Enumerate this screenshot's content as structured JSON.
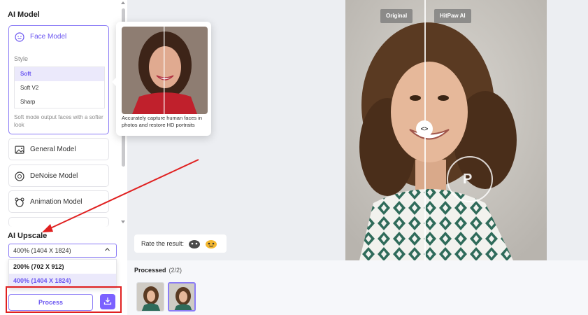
{
  "left_panel": {
    "ai_model_title": "AI Model",
    "face_model": {
      "label": "Face Model",
      "style_label": "Style",
      "styles": [
        "Soft",
        "Soft V2",
        "Sharp"
      ],
      "selected_style": "Soft",
      "description": "Soft mode output faces with a softer look"
    },
    "models": [
      {
        "label": "General Model",
        "icon": "image-icon"
      },
      {
        "label": "DeNoise Model",
        "icon": "denoise-icon"
      },
      {
        "label": "Animation Model",
        "icon": "animation-icon"
      }
    ],
    "ai_upscale_title": "AI Upscale",
    "upscale_selected": "400% (1404 X 1824)",
    "upscale_options": [
      "200% (702 X 912)",
      "400% (1404 X 1824)"
    ],
    "process_label": "Process"
  },
  "popover": {
    "text": "Accurately capture human faces in photos and restore HD portraits"
  },
  "preview": {
    "original_tag": "Original",
    "ai_tag": "HitPaw AI",
    "compare_handle": "<>",
    "rate_label": "Rate the result:"
  },
  "processed": {
    "label": "Processed",
    "count": "(2/2)"
  },
  "colors": {
    "accent": "#7b61ff",
    "annotation_red": "#e02020"
  }
}
